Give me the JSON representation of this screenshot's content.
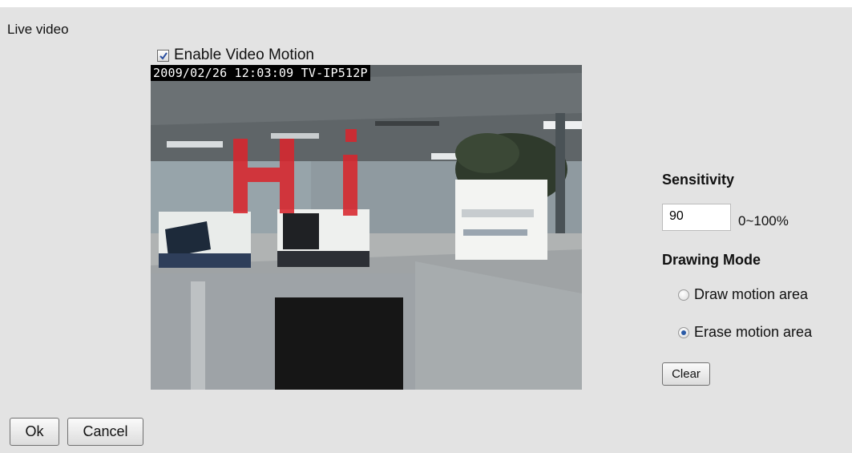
{
  "section": {
    "title": "Live video"
  },
  "motion": {
    "enable_label": "Enable Video Motion",
    "enabled": true
  },
  "video": {
    "osd_text": "2009/02/26 12:03:09 TV-IP512P",
    "overlay_text": "Hi"
  },
  "settings": {
    "sensitivity_label": "Sensitivity",
    "sensitivity_value": "90",
    "sensitivity_range": "0~100%",
    "drawing_mode_label": "Drawing Mode",
    "modes": [
      {
        "label": "Draw motion area",
        "selected": false
      },
      {
        "label": "Erase motion area",
        "selected": true
      }
    ],
    "clear_label": "Clear"
  },
  "footer": {
    "ok_label": "Ok",
    "cancel_label": "Cancel"
  },
  "colors": {
    "panel": "#e3e3e3",
    "overlay_red": "#d8262d",
    "radio_dot": "#2a5aa6"
  }
}
